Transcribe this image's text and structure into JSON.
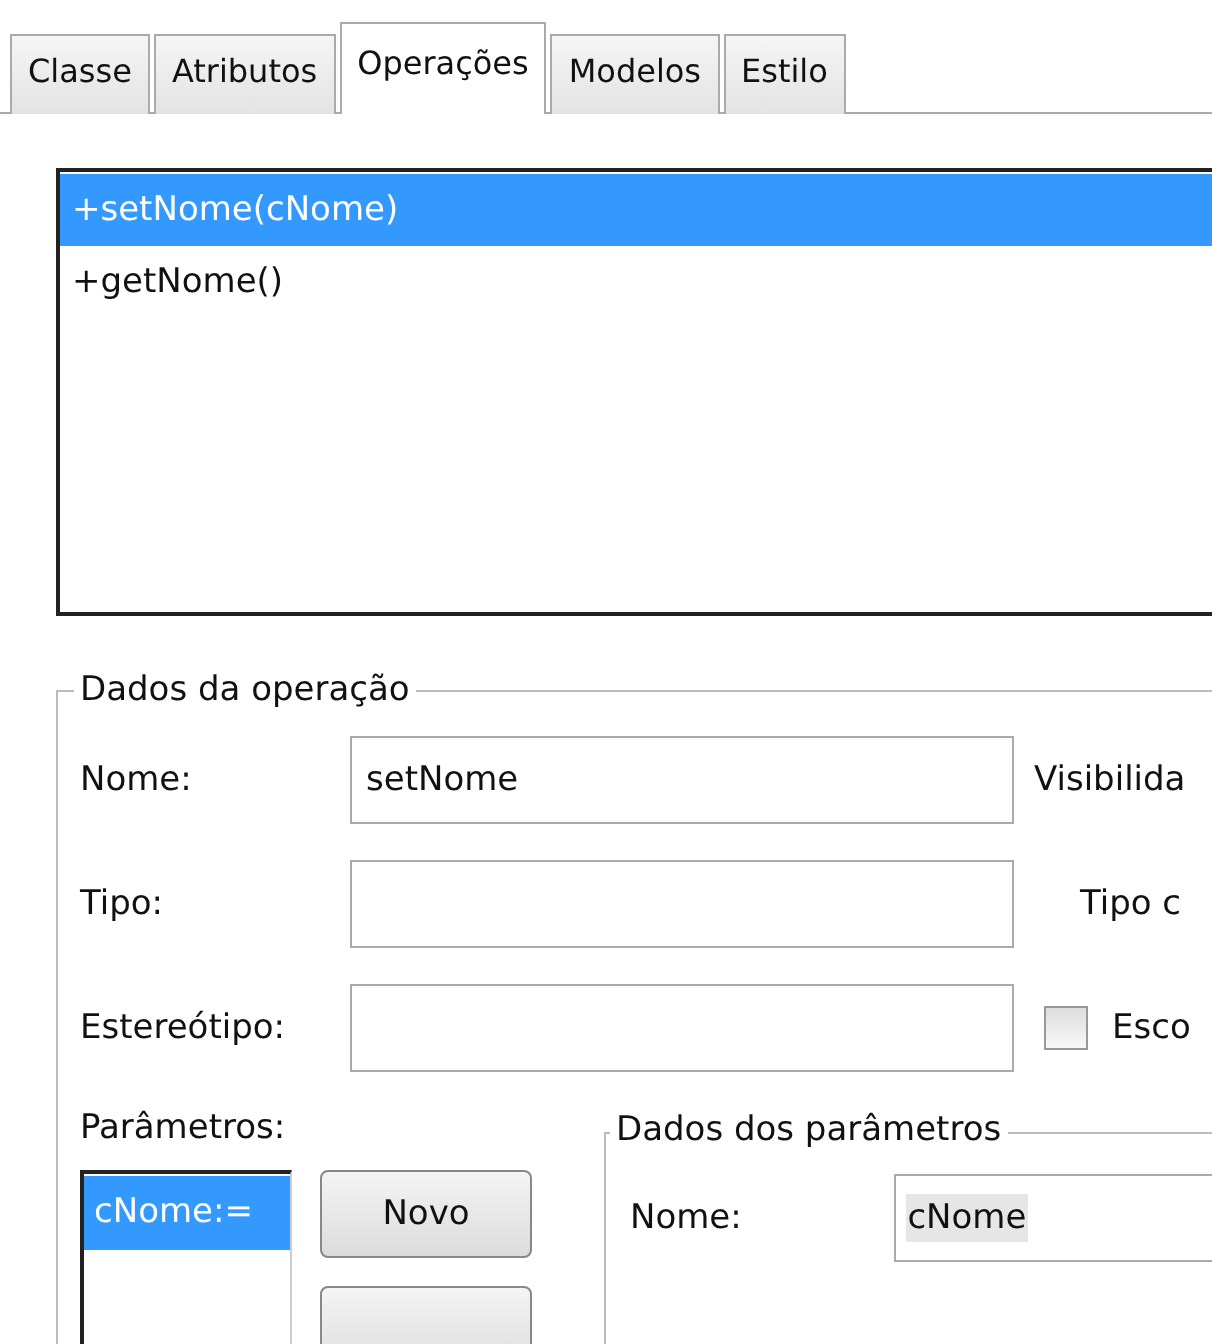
{
  "tabs": [
    {
      "label": "Classe",
      "selected": false
    },
    {
      "label": "Atributos",
      "selected": false
    },
    {
      "label": "Operações",
      "selected": true
    },
    {
      "label": "Modelos",
      "selected": false
    },
    {
      "label": "Estilo",
      "selected": false
    }
  ],
  "operations": [
    {
      "text": "+setNome(cNome)",
      "selected": true
    },
    {
      "text": "+getNome()",
      "selected": false
    }
  ],
  "operation_data": {
    "title": "Dados da operação",
    "name_label": "Nome:",
    "name_value": "setNome",
    "visibility_label": "Visibilida",
    "type_label": "Tipo:",
    "type_value_label": "Tipo c",
    "stereotype_label": "Estereótipo:",
    "checkbox": {
      "label": "Esco",
      "checked": false
    },
    "parameters_label": "Parâmetros:",
    "parameters": [
      {
        "text": "cNome:=",
        "selected": true
      }
    ],
    "new_button": {
      "label": "Novo"
    },
    "parameter_data": {
      "title": "Dados dos parâmetros",
      "name_label": "Nome:",
      "name_value": "cNome"
    }
  }
}
